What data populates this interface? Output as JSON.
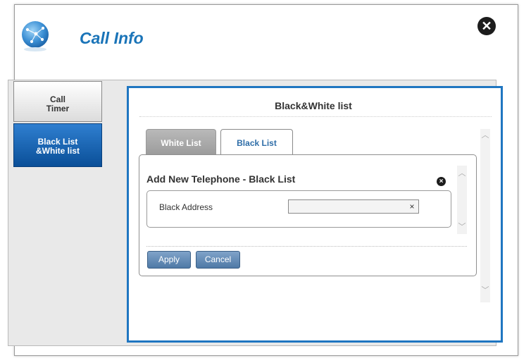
{
  "window": {
    "title": "Call Info",
    "close_icon": "close-icon"
  },
  "sidebar": {
    "items": [
      {
        "label_line1": "Call",
        "label_line2": "Timer",
        "selected": false
      },
      {
        "label_line1": "Black List",
        "label_line2": "&White list",
        "selected": true
      }
    ]
  },
  "panel": {
    "title": "Black&White list",
    "tabs": [
      {
        "label": "White List",
        "active": false
      },
      {
        "label": "Black List",
        "active": true
      }
    ]
  },
  "form": {
    "title": "Add New Telephone - Black List",
    "close_symbol": "×",
    "field_label": "Black Address",
    "field_value": "",
    "clear_symbol": "×",
    "apply_label": "Apply",
    "cancel_label": "Cancel"
  },
  "colors": {
    "accent_blue": "#1f76c1",
    "title_blue": "#1a74b8",
    "nav_selected": "#0a4f98",
    "button_blue": "#5a82ad"
  }
}
